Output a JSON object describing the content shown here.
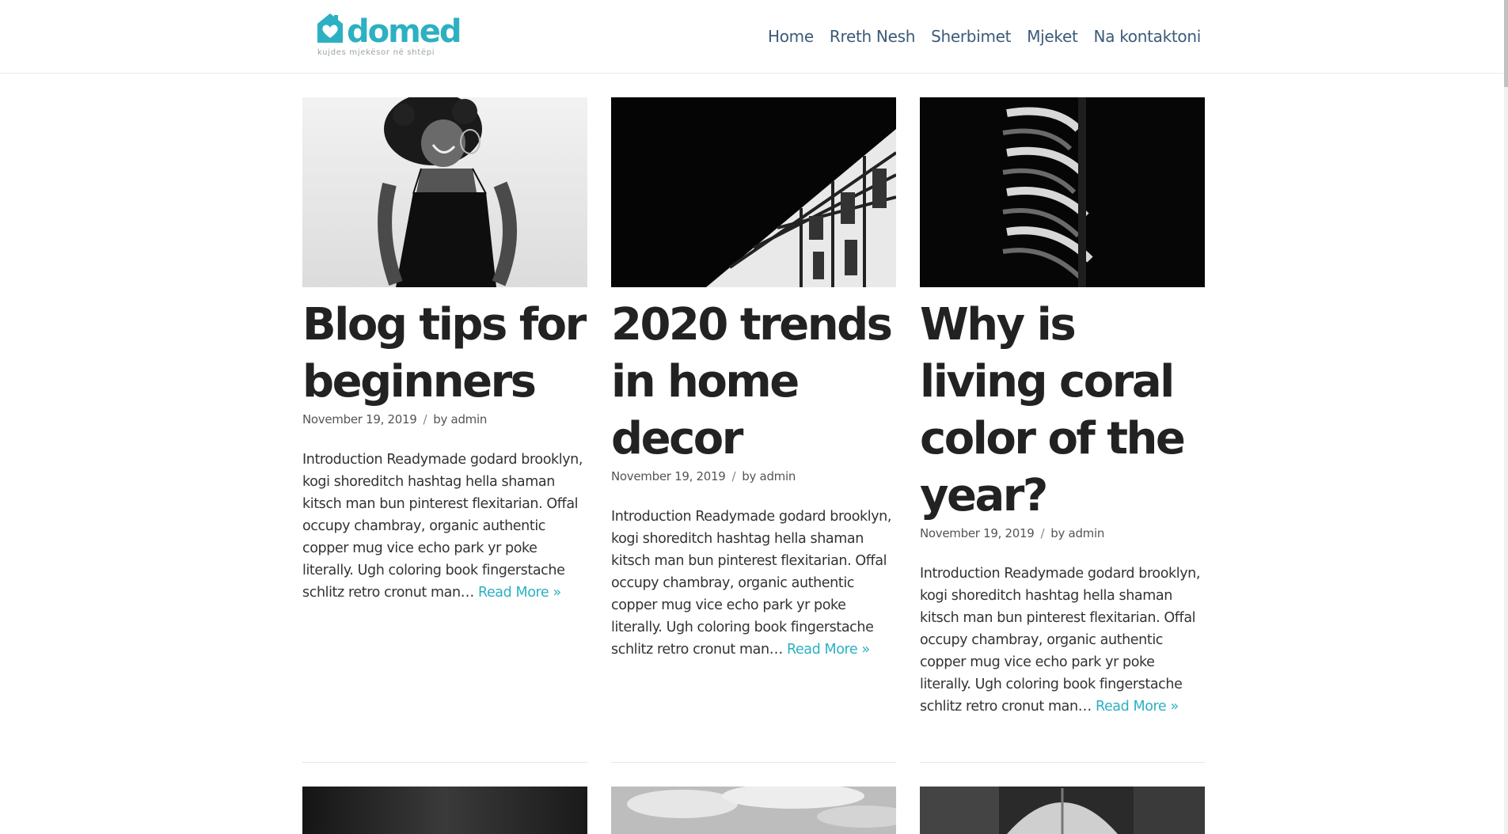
{
  "site": {
    "logo_name": "domed",
    "tagline": "kujdes mjekësor në shtëpi",
    "brand_color": "#2cb0c2",
    "nav_color": "#3c5a7a"
  },
  "nav": {
    "items": [
      {
        "label": "Home"
      },
      {
        "label": "Rreth Nesh"
      },
      {
        "label": "Sherbimet"
      },
      {
        "label": "Mjeket"
      },
      {
        "label": "Na kontaktoni"
      }
    ]
  },
  "posts": [
    {
      "title": "Blog tips for beginners",
      "date": "November 19, 2019",
      "separator": "/",
      "author_prefix": "by",
      "author": "admin",
      "excerpt": "Introduction Readymade godard brooklyn, kogi shoreditch hashtag hella shaman kitsch man bun pinterest flexitarian. Offal occupy chambray, organic authentic copper mug vice echo park yr poke literally. Ugh coloring book fingerstache schlitz retro cronut man…",
      "read_more": "Read More »",
      "image": "woman-portrait-photo"
    },
    {
      "title": "2020 trends in home decor",
      "date": "November 19, 2019",
      "separator": "/",
      "author_prefix": "by",
      "author": "admin",
      "excerpt": "Introduction Readymade godard brooklyn, kogi shoreditch hashtag hella shaman kitsch man bun pinterest flexitarian. Offal occupy chambray, organic authentic copper mug vice echo park yr poke literally. Ugh coloring book fingerstache schlitz retro cronut man…",
      "read_more": "Read More »",
      "image": "building-facade-photo"
    },
    {
      "title": "Why is living coral color of the year?",
      "date": "November 19, 2019",
      "separator": "/",
      "author_prefix": "by",
      "author": "admin",
      "excerpt": "Introduction Readymade godard brooklyn, kogi shoreditch hashtag hella shaman kitsch man bun pinterest flexitarian. Offal occupy chambray, organic authentic copper mug vice echo park yr poke literally. Ugh coloring book fingerstache schlitz retro cronut man…",
      "read_more": "Read More »",
      "image": "spiral-staircase-photo"
    }
  ],
  "next_row_images": [
    "dark-gradient-photo",
    "cloudy-sky-photo",
    "dome-building-photo"
  ]
}
